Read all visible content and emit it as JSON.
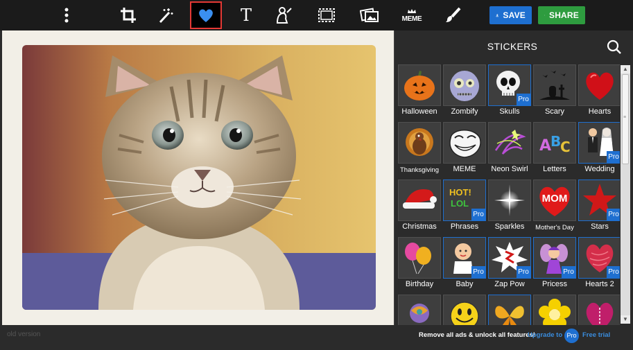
{
  "toolbar": {
    "tools": [
      {
        "name": "menu",
        "icon": "more-vertical-icon"
      },
      {
        "name": "crop",
        "icon": "crop-icon"
      },
      {
        "name": "effects",
        "icon": "magic-wand-icon"
      },
      {
        "name": "stickers",
        "icon": "heart-icon",
        "active": true
      },
      {
        "name": "text",
        "icon": "text-icon",
        "glyph": "T"
      },
      {
        "name": "touch-up",
        "icon": "face-brush-icon"
      },
      {
        "name": "frames",
        "icon": "frame-icon"
      },
      {
        "name": "collage",
        "icon": "picture-icon"
      },
      {
        "name": "meme",
        "icon": "meme-icon",
        "glyph": "MEME"
      },
      {
        "name": "paint",
        "icon": "paintbrush-icon"
      }
    ],
    "save_label": "SAVE",
    "share_label": "SHARE",
    "save_color": "#1e6fd0",
    "share_color": "#2e9c3f",
    "active_border_color": "#e53935"
  },
  "panel": {
    "title": "STICKERS",
    "search_icon": "search-icon",
    "categories": [
      {
        "label": "Halloween",
        "pro": false
      },
      {
        "label": "Zombify",
        "pro": false
      },
      {
        "label": "Skulls",
        "pro": true
      },
      {
        "label": "Scary",
        "pro": false
      },
      {
        "label": "Hearts",
        "pro": false
      },
      {
        "label": "Thanksgiving",
        "pro": false
      },
      {
        "label": "MEME",
        "pro": false
      },
      {
        "label": "Neon Swirl",
        "pro": false
      },
      {
        "label": "Letters",
        "pro": false
      },
      {
        "label": "Wedding",
        "pro": true
      },
      {
        "label": "Christmas",
        "pro": false
      },
      {
        "label": "Phrases",
        "pro": true,
        "thumb_text": [
          "HOT!",
          "LOL"
        ]
      },
      {
        "label": "Sparkles",
        "pro": false
      },
      {
        "label": "Mother's Day",
        "pro": false,
        "thumb_text": [
          "MOM"
        ]
      },
      {
        "label": "Stars",
        "pro": true
      },
      {
        "label": "Birthday",
        "pro": false
      },
      {
        "label": "Baby",
        "pro": true
      },
      {
        "label": "Zap Pow",
        "pro": true
      },
      {
        "label": "Pricess",
        "pro": true
      },
      {
        "label": "Hearts 2",
        "pro": true
      },
      {
        "label": "",
        "pro": false
      },
      {
        "label": "",
        "pro": false
      },
      {
        "label": "",
        "pro": true
      },
      {
        "label": "",
        "pro": false
      },
      {
        "label": "",
        "pro": false
      }
    ],
    "pro_badge": "Pro"
  },
  "footer": {
    "old_version": "old version",
    "promo": "Remove all ads & unlock all features!",
    "upgrade": "Upgrade to",
    "pro": "Pro",
    "free_trial": "Free trial"
  }
}
